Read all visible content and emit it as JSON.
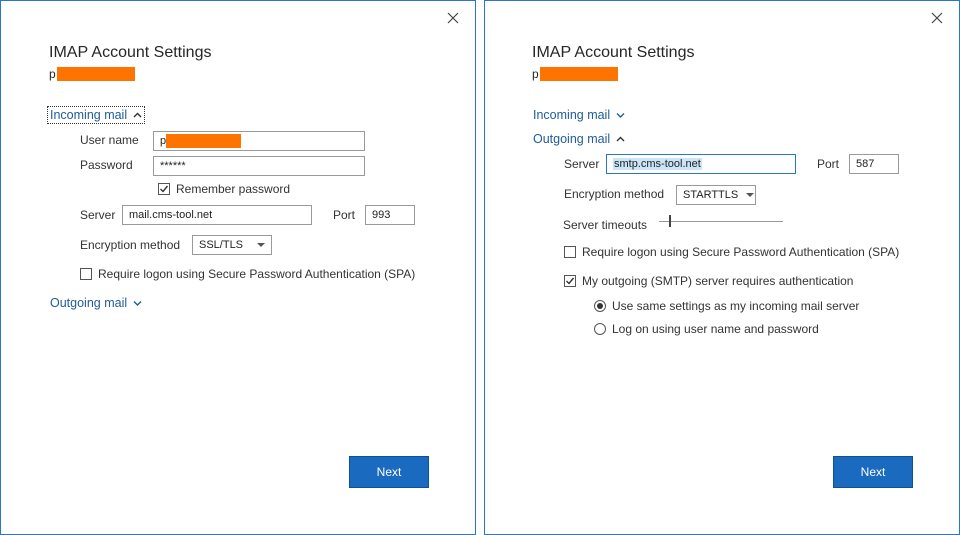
{
  "left": {
    "title": "IMAP Account Settings",
    "email_prefix": "p",
    "incoming": {
      "label": "Incoming mail",
      "username_label": "User name",
      "username_prefix": "p",
      "password_label": "Password",
      "password_value": "******",
      "remember_label": "Remember password",
      "remember_checked": true,
      "server_label": "Server",
      "server_value": "mail.cms-tool.net",
      "port_label": "Port",
      "port_value": "993",
      "encryption_label": "Encryption method",
      "encryption_value": "SSL/TLS",
      "spa_label": "Require logon using Secure Password Authentication (SPA)",
      "spa_checked": false
    },
    "outgoing": {
      "label": "Outgoing mail"
    },
    "next_label": "Next"
  },
  "right": {
    "title": "IMAP Account Settings",
    "email_prefix": "p",
    "incoming": {
      "label": "Incoming mail"
    },
    "outgoing": {
      "label": "Outgoing mail",
      "server_label": "Server",
      "server_value": "smtp.cms-tool.net",
      "port_label": "Port",
      "port_value": "587",
      "encryption_label": "Encryption method",
      "encryption_value": "STARTTLS",
      "timeouts_label": "Server timeouts",
      "timeouts_level": 0.08,
      "spa_label": "Require logon using Secure Password Authentication (SPA)",
      "spa_checked": false,
      "auth_label": "My outgoing (SMTP) server requires authentication",
      "auth_checked": true,
      "radio_same_label": "Use same settings as my incoming mail server",
      "radio_same_selected": true,
      "radio_logon_label": "Log on using user name and password",
      "radio_logon_selected": false
    },
    "next_label": "Next"
  },
  "colors": {
    "accent": "#1a6bbf",
    "border": "#2b76c8",
    "link": "#1f5c99",
    "redaction": "#ff7300",
    "selection": "#cce4f7"
  },
  "icons": {
    "close": "close-icon",
    "expand": "chevron-down-icon",
    "collapse": "chevron-up-icon",
    "check": "checkmark-icon"
  }
}
